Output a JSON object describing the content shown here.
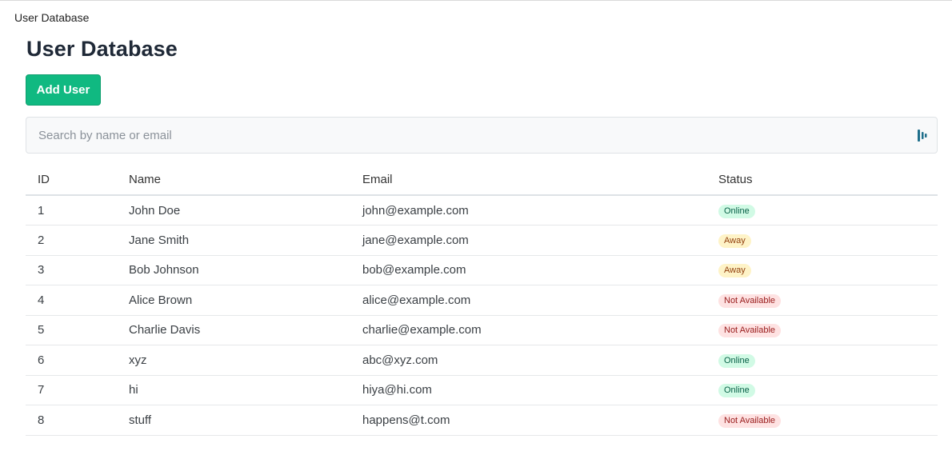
{
  "tab": {
    "title": "User Database"
  },
  "header": {
    "title": "User Database",
    "add_button_label": "Add User"
  },
  "search": {
    "placeholder": "Search by name or email",
    "value": ""
  },
  "table": {
    "columns": [
      "ID",
      "Name",
      "Email",
      "Status"
    ],
    "rows": [
      {
        "id": "1",
        "name": "John Doe",
        "email": "john@example.com",
        "status": "Online"
      },
      {
        "id": "2",
        "name": "Jane Smith",
        "email": "jane@example.com",
        "status": "Away"
      },
      {
        "id": "3",
        "name": "Bob Johnson",
        "email": "bob@example.com",
        "status": "Away"
      },
      {
        "id": "4",
        "name": "Alice Brown",
        "email": "alice@example.com",
        "status": "Not Available"
      },
      {
        "id": "5",
        "name": "Charlie Davis",
        "email": "charlie@example.com",
        "status": "Not Available"
      },
      {
        "id": "6",
        "name": "xyz",
        "email": "abc@xyz.com",
        "status": "Online"
      },
      {
        "id": "7",
        "name": "hi",
        "email": "hiya@hi.com",
        "status": "Online"
      },
      {
        "id": "8",
        "name": "stuff",
        "email": "happens@t.com",
        "status": "Not Available"
      }
    ]
  },
  "colors": {
    "accent": "#10b981",
    "online_bg": "#d1fae5",
    "away_bg": "#fef3c7",
    "not_available_bg": "#fee2e2"
  },
  "icons": {
    "search_field_icon": "password-manager-icon"
  }
}
